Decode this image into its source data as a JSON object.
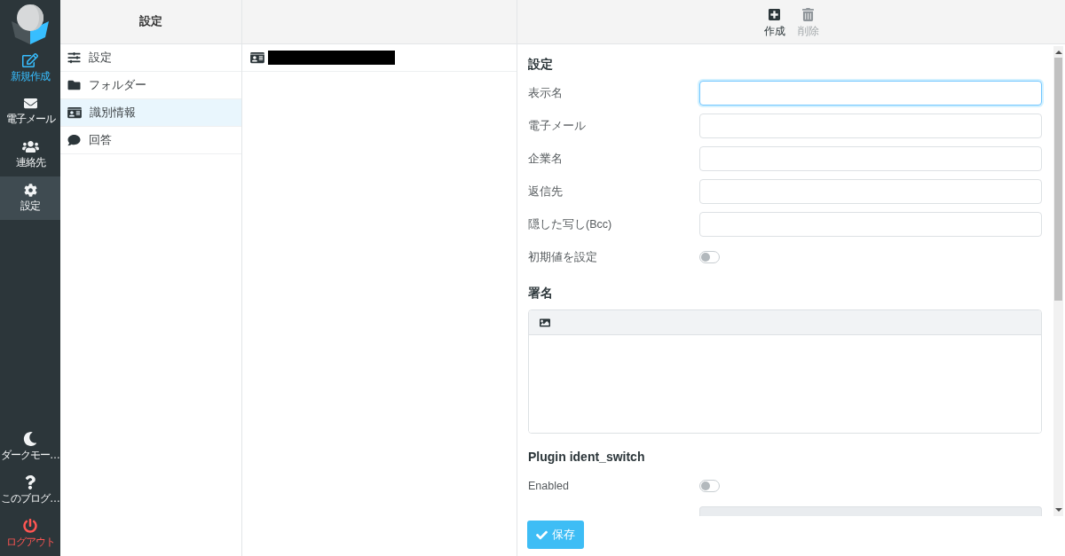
{
  "nav": {
    "items": [
      {
        "label": "新規作成",
        "kind": "compose",
        "selected": false
      },
      {
        "label": "電子メール",
        "kind": "mail",
        "selected": false
      },
      {
        "label": "連絡先",
        "kind": "contacts",
        "selected": false
      },
      {
        "label": "設定",
        "kind": "settings",
        "selected": true
      }
    ],
    "bottom_items": [
      {
        "label": "ダークモー…",
        "kind": "theme",
        "selected": false
      },
      {
        "label": "このブログ…",
        "kind": "about",
        "selected": false
      },
      {
        "label": "ログアウト",
        "kind": "logout",
        "selected": false
      }
    ]
  },
  "settings_menu": {
    "title": "設定",
    "items": [
      {
        "label": "設定",
        "kind": "preferences",
        "selected": false
      },
      {
        "label": "フォルダー",
        "kind": "folders",
        "selected": false
      },
      {
        "label": "識別情報",
        "kind": "identities",
        "selected": true
      },
      {
        "label": "回答",
        "kind": "responses",
        "selected": false
      }
    ]
  },
  "identities": [
    {
      "redacted": true,
      "selected": false
    }
  ],
  "toolbar": {
    "buttons": [
      {
        "label": "作成",
        "kind": "create",
        "disabled": false
      },
      {
        "label": "削除",
        "kind": "delete",
        "disabled": true
      }
    ]
  },
  "form": {
    "sections": [
      {
        "title": "設定",
        "fields": [
          {
            "kind": "text",
            "label": "表示名",
            "focused": true,
            "disabled": false
          },
          {
            "kind": "text",
            "label": "電子メール",
            "focused": false,
            "disabled": false
          },
          {
            "kind": "text",
            "label": "企業名",
            "focused": false,
            "disabled": false
          },
          {
            "kind": "text",
            "label": "返信先",
            "focused": false,
            "disabled": false
          },
          {
            "kind": "text",
            "label": "隠した写し(Bcc)",
            "focused": false,
            "disabled": false
          },
          {
            "kind": "toggle",
            "label": "初期値を設定",
            "on": false
          }
        ]
      },
      {
        "title": "署名",
        "fields": [
          {
            "kind": "editor"
          }
        ]
      },
      {
        "title": "Plugin ident_switch",
        "fields": [
          {
            "kind": "toggle",
            "label": "Enabled",
            "on": false
          },
          {
            "kind": "text",
            "focused": false,
            "disabled": true
          }
        ]
      }
    ]
  },
  "save_button": {
    "label": "保存"
  }
}
